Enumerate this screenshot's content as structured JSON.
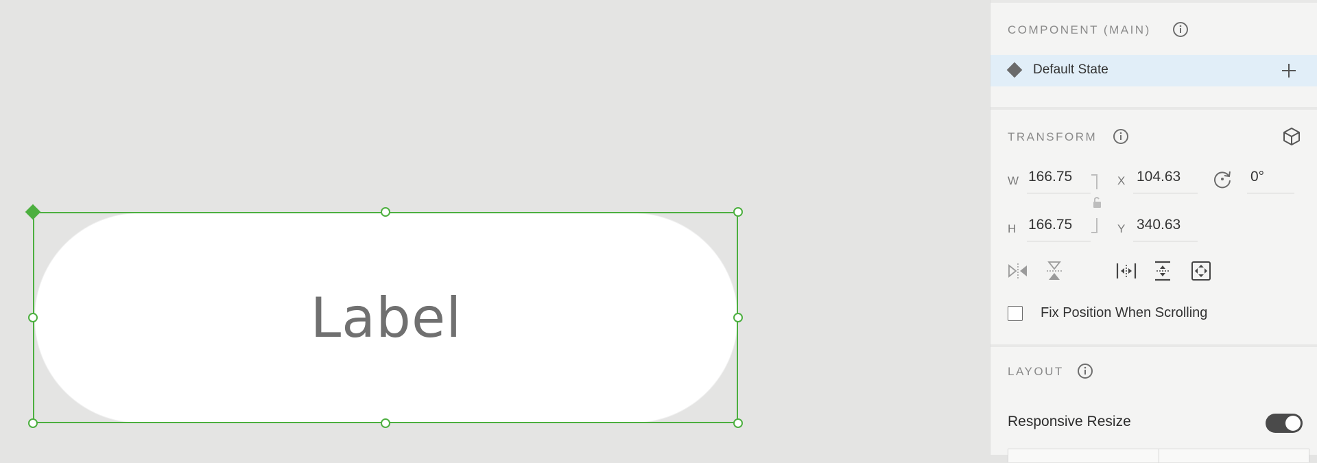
{
  "canvas": {
    "button_label": "Label"
  },
  "panel": {
    "component": {
      "title": "COMPONENT (MAIN)",
      "state_label": "Default State"
    },
    "transform": {
      "title": "TRANSFORM",
      "w_label": "W",
      "w_value": "166.75",
      "h_label": "H",
      "h_value": "166.75",
      "x_label": "X",
      "x_value": "104.63",
      "y_label": "Y",
      "y_value": "340.63",
      "rotation_value": "0°",
      "fix_position_label": "Fix Position When Scrolling"
    },
    "layout": {
      "title": "LAYOUT",
      "responsive_resize_label": "Responsive Resize"
    }
  },
  "colors": {
    "selection": "#4caf3f",
    "state_highlight": "#e1eef8",
    "toggle_on": "#4a4a4a"
  }
}
